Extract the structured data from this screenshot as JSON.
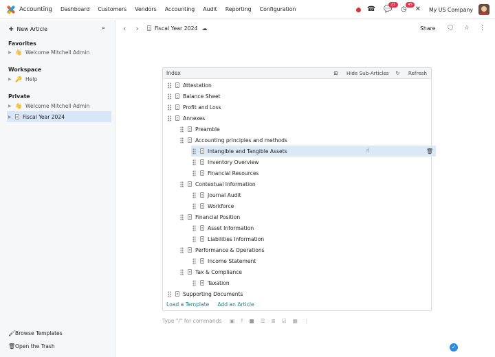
{
  "topbar": {
    "app_name": "Accounting",
    "menu": [
      "Dashboard",
      "Customers",
      "Vendors",
      "Accounting",
      "Audit",
      "Reporting",
      "Configuration"
    ],
    "messages_badge": "21",
    "activity_badge": "45",
    "company": "My US Company"
  },
  "sidebar": {
    "new_article": "New Article",
    "favorites_title": "Favorites",
    "favorites": [
      {
        "emoji": "👋",
        "label": "Welcome Mitchell Admin"
      }
    ],
    "workspace_title": "Workspace",
    "workspace": [
      {
        "emoji": "🔑",
        "label": "Help"
      }
    ],
    "private_title": "Private",
    "private": [
      {
        "emoji": "👋",
        "label": "Welcome Mitchell Admin"
      },
      {
        "emoji": "",
        "label": "Fiscal Year 2024"
      }
    ],
    "browse_templates": "Browse Templates",
    "open_trash": "Open the Trash"
  },
  "header": {
    "breadcrumb": "Fiscal Year 2024",
    "share": "Share"
  },
  "index": {
    "title": "Index",
    "hide_sub": "Hide Sub-Articles",
    "refresh": "Refresh",
    "rows": [
      {
        "label": "Attestation",
        "level": 0
      },
      {
        "label": "Balance Sheet",
        "level": 0
      },
      {
        "label": "Profit and Loss",
        "level": 0
      },
      {
        "label": "Annexes",
        "level": 0
      },
      {
        "label": "Preamble",
        "level": 1
      },
      {
        "label": "Accounting principles and methods",
        "level": 1
      },
      {
        "label": "Intangible and Tangible Assets",
        "level": 2,
        "selected": true
      },
      {
        "label": "Inventory Overview",
        "level": 2
      },
      {
        "label": "Financial Resources",
        "level": 2
      },
      {
        "label": "Contextual Information",
        "level": 1
      },
      {
        "label": "Journal Audit",
        "level": 2
      },
      {
        "label": "Workforce",
        "level": 2
      },
      {
        "label": "Financial Position",
        "level": 1
      },
      {
        "label": "Asset Information",
        "level": 2
      },
      {
        "label": "Liabilities Information",
        "level": 2
      },
      {
        "label": "Performance & Operations",
        "level": 1
      },
      {
        "label": "Income Statement",
        "level": 2
      },
      {
        "label": "Tax & Compliance",
        "level": 1
      },
      {
        "label": "Taxation",
        "level": 2
      },
      {
        "label": "Supporting Documents",
        "level": 0
      }
    ],
    "load_template": "Load a Template",
    "add_article": "Add an Article"
  },
  "editor": {
    "placeholder": "Type \"/\" for commands"
  }
}
